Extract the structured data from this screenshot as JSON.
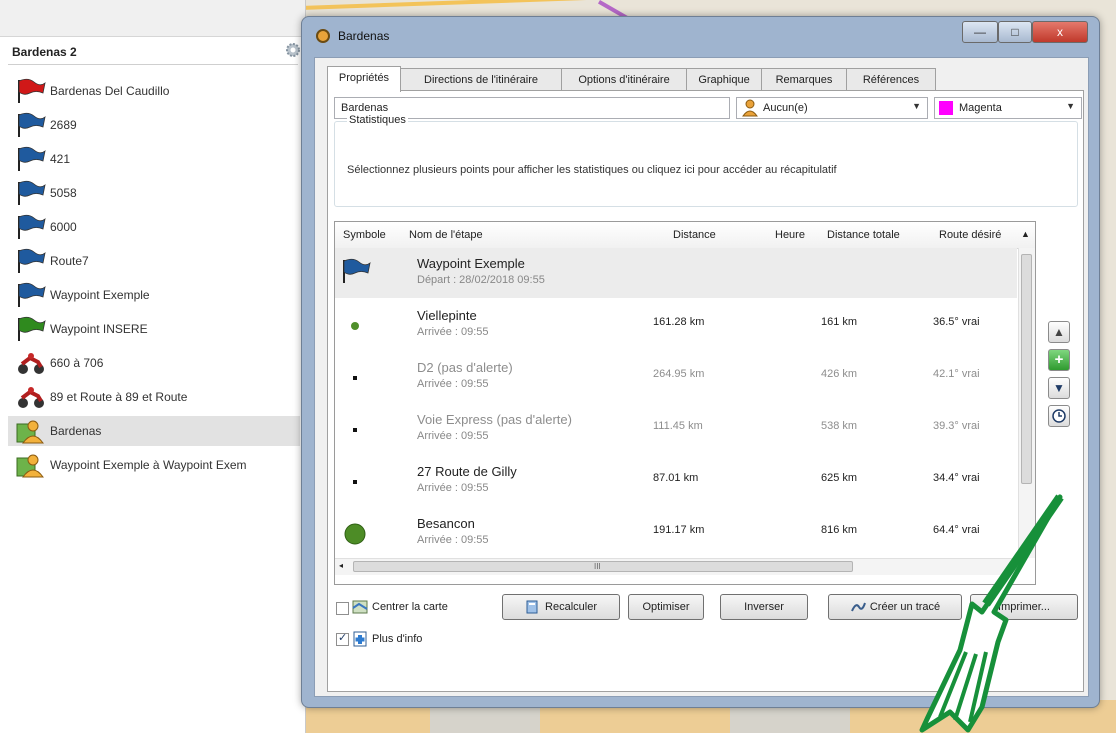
{
  "left_panel": {
    "title": "Bardenas 2",
    "items": [
      {
        "label": "Bardenas Del Caudillo",
        "icon": "red-flag-icon",
        "color": "#d01818"
      },
      {
        "label": "2689",
        "icon": "blue-flag-icon",
        "color": "#1f5a9e"
      },
      {
        "label": "421",
        "icon": "blue-flag-icon",
        "color": "#1f5a9e"
      },
      {
        "label": "5058",
        "icon": "blue-flag-icon",
        "color": "#1f5a9e"
      },
      {
        "label": "6000",
        "icon": "blue-flag-icon",
        "color": "#1f5a9e"
      },
      {
        "label": "Route7",
        "icon": "blue-flag-icon",
        "color": "#1f5a9e"
      },
      {
        "label": "Waypoint Exemple",
        "icon": "blue-flag-icon",
        "color": "#1f5a9e"
      },
      {
        "label": "Waypoint INSERE",
        "icon": "green-flag-icon",
        "color": "#2f8a1e"
      },
      {
        "label": "660 à 706",
        "icon": "motorbike-route-icon"
      },
      {
        "label": "89 et Route à 89 et Route",
        "icon": "motorbike-route-icon"
      },
      {
        "label": "Bardenas",
        "icon": "person-route-icon",
        "selected": true
      },
      {
        "label": "Waypoint Exemple à Waypoint Exem",
        "icon": "person-route-icon"
      }
    ]
  },
  "dialog": {
    "title": "Bardenas",
    "window_buttons": {
      "minimize": "—",
      "maximize": "□",
      "close": "x"
    },
    "tabs": [
      {
        "label": "Propriétés",
        "active": true
      },
      {
        "label": "Directions de l'itinéraire"
      },
      {
        "label": "Options d'itinéraire"
      },
      {
        "label": "Graphique"
      },
      {
        "label": "Remarques"
      },
      {
        "label": "Références"
      }
    ],
    "name_value": "Bardenas",
    "profile_value": "Aucun(e)",
    "color_value": "Magenta",
    "color_swatch": "#ff00ff",
    "stats": {
      "title": "Statistiques",
      "text": "Sélectionnez plusieurs points pour afficher les statistiques ou cliquez ici pour accéder au récapitulatif"
    },
    "columns": [
      "Symbole",
      "Nom de l'étape",
      "Distance",
      "Heure",
      "Distance totale",
      "Route désiré"
    ],
    "rows": [
      {
        "symbol": "blue-flag-icon",
        "name": "Waypoint Exemple",
        "sub": "Départ : 28/02/2018 09:55",
        "distance": "",
        "total": "",
        "course": "",
        "highlight": true
      },
      {
        "symbol": "small-green-dot-icon",
        "name": "Viellepinte",
        "sub": "Arrivée : 09:55",
        "distance": "161.28 km",
        "total": "161 km",
        "course": "36.5° vrai"
      },
      {
        "symbol": "black-dot-icon",
        "name": "D2 (pas d'alerte)",
        "sub": "Arrivée : 09:55",
        "distance": "264.95 km",
        "total": "426 km",
        "course": "42.1° vrai",
        "grey": true
      },
      {
        "symbol": "black-dot-icon",
        "name": "Voie Express (pas d'alerte)",
        "sub": "Arrivée : 09:55",
        "distance": "111.45 km",
        "total": "538 km",
        "course": "39.3° vrai",
        "grey": true
      },
      {
        "symbol": "black-dot-icon",
        "name": "27 Route de Gilly",
        "sub": "Arrivée : 09:55",
        "distance": "87.01 km",
        "total": "625 km",
        "course": "34.4° vrai"
      },
      {
        "symbol": "large-green-dot-icon",
        "name": "Besancon",
        "sub": "Arrivée : 09:55",
        "distance": "191.17 km",
        "total": "816 km",
        "course": "64.4° vrai"
      }
    ],
    "scroll_grip": "III",
    "buttons": {
      "center_map": "Centrer la carte",
      "recalculate": "Recalculer",
      "optimize": "Optimiser",
      "reverse": "Inverser",
      "create_track": "Créer un tracé",
      "print": "Imprimer..."
    },
    "more_info": "Plus d'info",
    "more_info_checked": true,
    "center_map_checked": false
  }
}
